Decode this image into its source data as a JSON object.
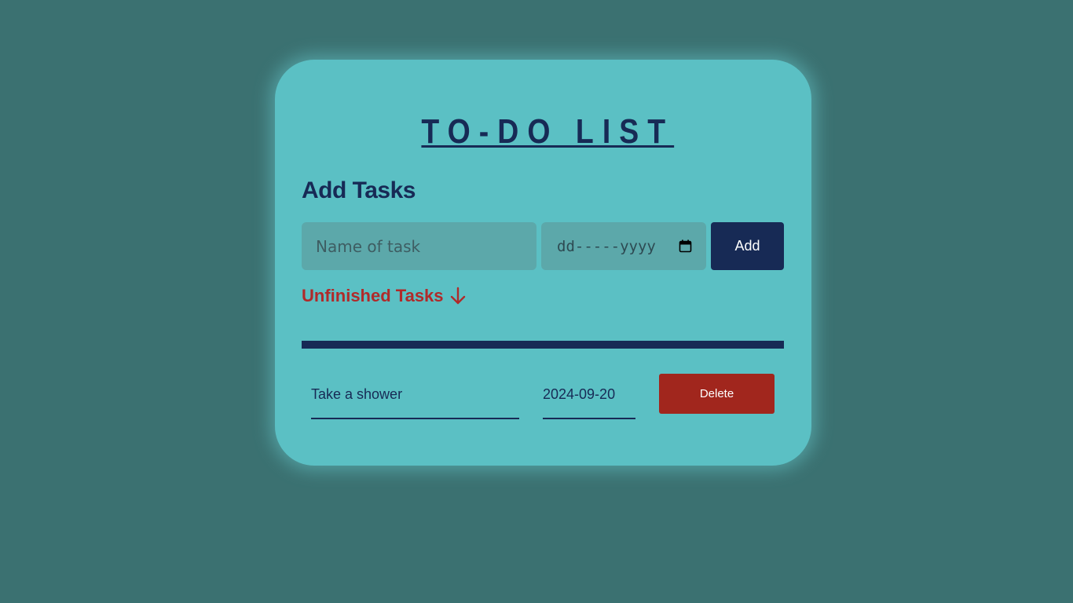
{
  "app": {
    "title": "TO-DO LIST"
  },
  "add_section": {
    "heading": "Add Tasks",
    "task_input": {
      "placeholder": "Name of task",
      "value": ""
    },
    "date_input": {
      "placeholder": "dd-----yyyy",
      "value": ""
    },
    "add_label": "Add"
  },
  "unfinished_section": {
    "heading": "Unfinished Tasks"
  },
  "tasks": [
    {
      "name": "Take a shower",
      "date": "2024-09-20",
      "delete_label": "Delete"
    }
  ],
  "icons": {
    "arrow": "arrow-down-icon",
    "calendar": "calendar-icon"
  },
  "colors": {
    "background": "#3b7171",
    "card": "#5bc0c4",
    "primary": "#172a55",
    "accent_red": "#b02a2a",
    "delete_red": "#a1261d",
    "input_bg": "#5ca8aa"
  }
}
